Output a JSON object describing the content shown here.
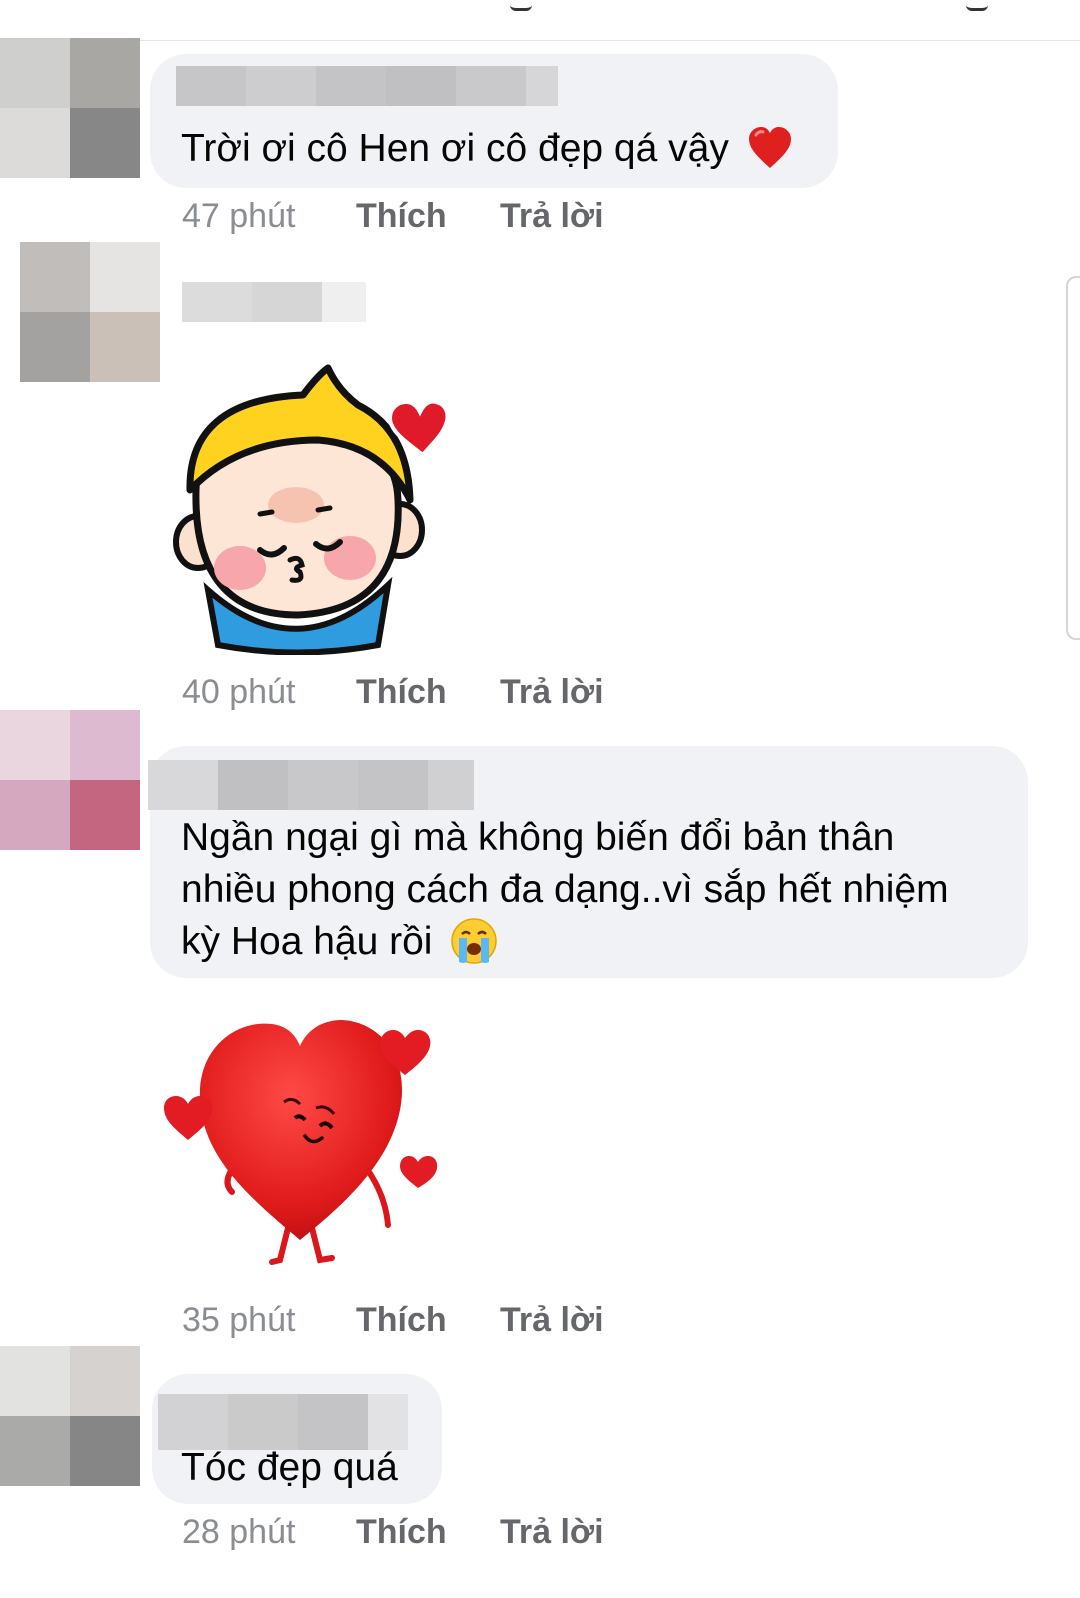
{
  "comments": [
    {
      "text": "Trời ơi cô Hen ơi cô đẹp qá vậy",
      "time": "47 phút",
      "like": "Thích",
      "reply": "Trả lời",
      "emoji": "heart-emoji"
    },
    {
      "sticker": "baby-kiss-sticker",
      "time": "40 phút",
      "like": "Thích",
      "reply": "Trả lời"
    },
    {
      "lines": [
        "Ngần ngại gì mà không biến đổi bản thân",
        "nhiều phong cách đa dạng..vì sắp hết nhiệm",
        "kỳ Hoa hậu rồi"
      ],
      "emoji": "crying-face-emoji",
      "sticker": "heart-character-sticker",
      "time": "35 phút",
      "like": "Thích",
      "reply": "Trả lời"
    },
    {
      "text": "Tóc đẹp quá",
      "time": "28 phút",
      "like": "Thích",
      "reply": "Trả lời"
    }
  ],
  "colors": {
    "bubble": "#f0f2f5",
    "text": "#050505",
    "meta": "#65676b",
    "time": "#8a8d91",
    "heart": "#e0201f"
  }
}
